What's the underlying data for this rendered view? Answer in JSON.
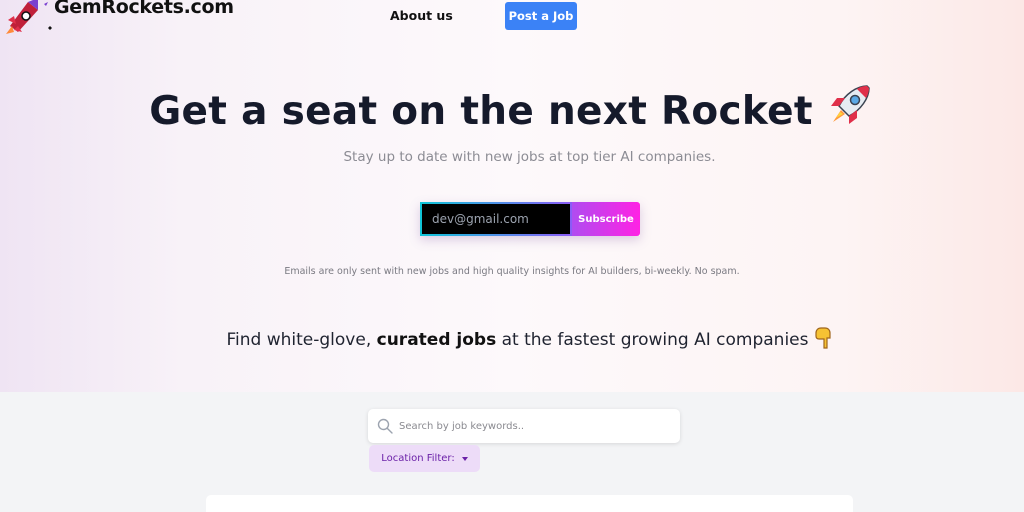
{
  "header": {
    "brand": "GemRockets.com",
    "nav_about": "About us",
    "post_job_label": "Post a Job"
  },
  "hero": {
    "title": "Get a seat on the next Rocket",
    "subtitle": "Stay up to date with new jobs at top tier AI companies.",
    "email_placeholder": "dev@gmail.com",
    "subscribe_label": "Subscribe",
    "note": "Emails are only sent with new jobs and high quality insights for AI builders, bi-weekly. No spam.",
    "tagline_pre": "Find white-glove, ",
    "tagline_bold": "curated jobs",
    "tagline_post": " at the fastest growing AI companies"
  },
  "filters": {
    "search_placeholder": "Search by job keywords..",
    "location_label": "Location Filter:"
  },
  "icons": {
    "logo": "rocket-logo-icon",
    "title_emoji": "rocket-icon",
    "tagline_emoji": "pointing-down-hand-icon",
    "search": "search-icon",
    "dropdown": "caret-down-icon"
  },
  "colors": {
    "post_button": "#3b82f6",
    "subscribe_gradient_start": "#b04cf0",
    "subscribe_gradient_end": "#ff22e4",
    "location_filter_bg": "#eddcf8",
    "location_filter_text": "#6b21a8"
  }
}
